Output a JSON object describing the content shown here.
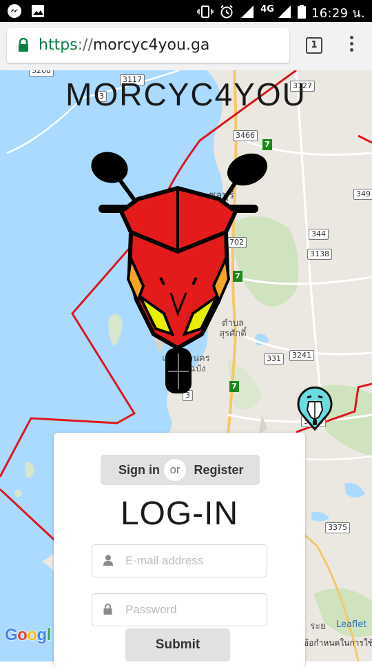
{
  "status_bar": {
    "time": "16:29 น.",
    "network": "4G",
    "icons": [
      "messenger-icon",
      "image-icon",
      "vibrate-icon",
      "alarm-icon",
      "signal-icon",
      "battery-icon"
    ]
  },
  "browser": {
    "url_scheme": "https",
    "url_separator": "://",
    "url_host": "morcyc4you.ga",
    "tab_count": "1",
    "secure_color": "#0b8043"
  },
  "map": {
    "brand_title": "MORCYC4YOU",
    "route_shields": [
      "3117",
      "3127",
      "3",
      "3466",
      "349",
      "344",
      "3138",
      "702",
      "331",
      "3241",
      "3",
      "3013",
      "3375",
      "3268"
    ],
    "green_shields": [
      "7",
      "7",
      "7"
    ],
    "place_labels": [
      "ชลบุรี",
      "ตำบล สุรศักดิ์",
      "เทศบาลนคร แหลมฉบัง",
      "ระย"
    ],
    "attribution": "Leaflet",
    "terms": "ข้อกำหนดในการใช้งาน",
    "google": "Google",
    "colors": {
      "water": "#aadaff",
      "land": "#ebe8e1",
      "route": "#e0151c",
      "marker": "#6bdde0"
    }
  },
  "login": {
    "signin_label": "Sign in",
    "or_label": "or",
    "register_label": "Register",
    "title": "LOG-IN",
    "email_placeholder": "E-mail address",
    "password_placeholder": "Password",
    "submit_label": "Submit"
  }
}
